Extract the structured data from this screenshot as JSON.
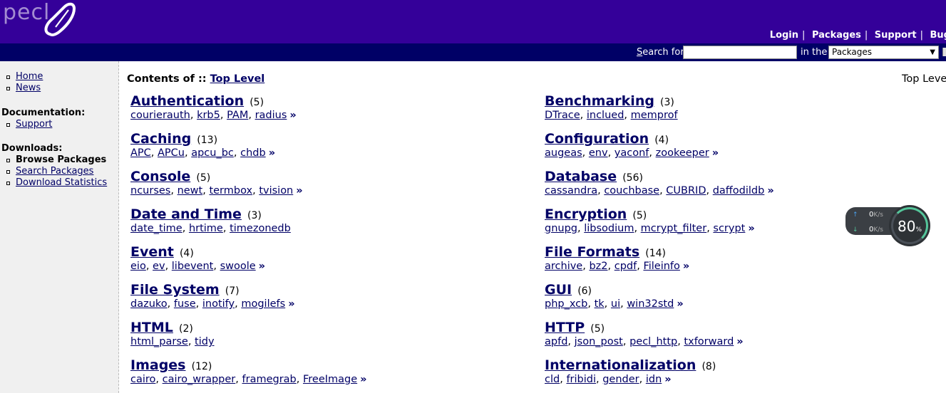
{
  "header": {
    "logo_text": "pecl",
    "nav": [
      "Login",
      "Packages",
      "Support",
      "Bug"
    ]
  },
  "search": {
    "label_prefix": "S",
    "label_rest": "earch for",
    "value": "",
    "in_the": "in the",
    "selected": "Packages"
  },
  "sidebar": {
    "top_links": [
      "Home",
      "News"
    ],
    "doc_heading": "Documentation:",
    "doc_links": [
      "Support"
    ],
    "dl_heading": "Downloads:",
    "dl_current": "Browse Packages",
    "dl_links": [
      "Search Packages",
      "Download Statistics"
    ]
  },
  "main": {
    "title_prefix": "Contents of :: ",
    "title_link": "Top Level",
    "right_label": "Top Leve"
  },
  "categories": [
    {
      "name": "Authentication",
      "count": "(5)",
      "subs": [
        "courierauth",
        "krb5",
        "PAM",
        "radius"
      ],
      "more": "»"
    },
    {
      "name": "Benchmarking",
      "count": "(3)",
      "subs": [
        "DTrace",
        "inclued",
        "memprof"
      ],
      "more": ""
    },
    {
      "name": "Caching",
      "count": "(13)",
      "subs": [
        "APC",
        "APCu",
        "apcu_bc",
        "chdb"
      ],
      "more": "»"
    },
    {
      "name": "Configuration",
      "count": "(4)",
      "subs": [
        "augeas",
        "env",
        "yaconf",
        "zookeeper"
      ],
      "more": "»"
    },
    {
      "name": "Console",
      "count": "(5)",
      "subs": [
        "ncurses",
        "newt",
        "termbox",
        "tvision"
      ],
      "more": "»"
    },
    {
      "name": "Database",
      "count": "(56)",
      "subs": [
        "cassandra",
        "couchbase",
        "CUBRID",
        "daffodildb"
      ],
      "more": "»"
    },
    {
      "name": "Date and Time",
      "count": "(3)",
      "subs": [
        "date_time",
        "hrtime",
        "timezonedb"
      ],
      "more": ""
    },
    {
      "name": "Encryption",
      "count": "(5)",
      "subs": [
        "gnupg",
        "libsodium",
        "mcrypt_filter",
        "scrypt"
      ],
      "more": "»"
    },
    {
      "name": "Event",
      "count": "(4)",
      "subs": [
        "eio",
        "ev",
        "libevent",
        "swoole"
      ],
      "more": "»"
    },
    {
      "name": "File Formats",
      "count": "(14)",
      "subs": [
        "archive",
        "bz2",
        "cpdf",
        "Fileinfo"
      ],
      "more": "»"
    },
    {
      "name": "File System",
      "count": "(7)",
      "subs": [
        "dazuko",
        "fuse",
        "inotify",
        "mogilefs"
      ],
      "more": "»"
    },
    {
      "name": "GUI",
      "count": "(6)",
      "subs": [
        "php_xcb",
        "tk",
        "ui",
        "win32std"
      ],
      "more": "»"
    },
    {
      "name": "HTML",
      "count": "(2)",
      "subs": [
        "html_parse",
        "tidy"
      ],
      "more": ""
    },
    {
      "name": "HTTP",
      "count": "(5)",
      "subs": [
        "apfd",
        "json_post",
        "pecl_http",
        "txforward"
      ],
      "more": "»"
    },
    {
      "name": "Images",
      "count": "(12)",
      "subs": [
        "cairo",
        "cairo_wrapper",
        "framegrab",
        "FreeImage"
      ],
      "more": "»"
    },
    {
      "name": "Internationalization",
      "count": "(8)",
      "subs": [
        "cld",
        "fribidi",
        "gender",
        "idn"
      ],
      "more": "»"
    }
  ],
  "widget": {
    "up_value": "0",
    "down_value": "0",
    "unit": "K/s",
    "percent": "80",
    "percent_sign": "%"
  }
}
